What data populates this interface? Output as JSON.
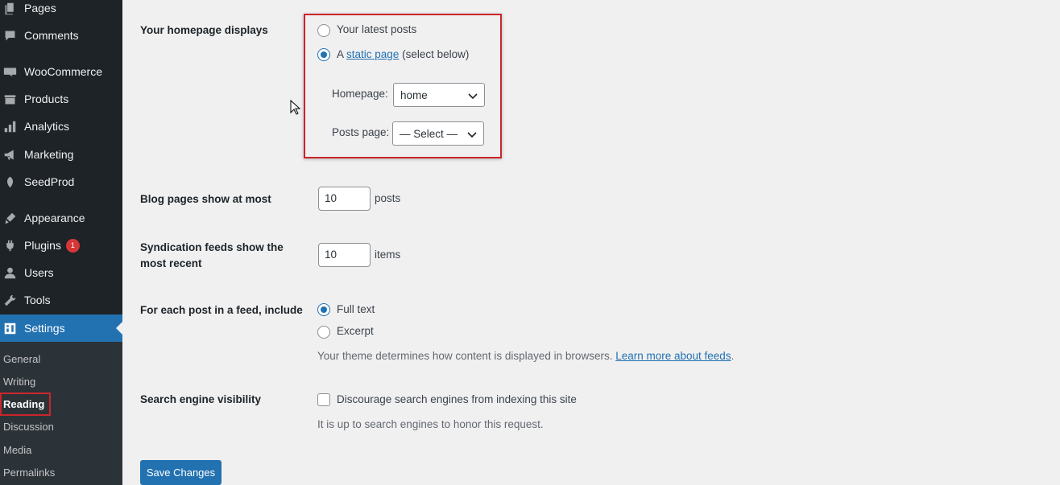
{
  "sidebar": {
    "items": [
      {
        "label": "Pages",
        "icon": "pages-icon"
      },
      {
        "label": "Comments",
        "icon": "comments-icon"
      },
      {
        "label": "WooCommerce",
        "icon": "woocommerce-icon"
      },
      {
        "label": "Products",
        "icon": "products-icon"
      },
      {
        "label": "Analytics",
        "icon": "analytics-icon"
      },
      {
        "label": "Marketing",
        "icon": "marketing-icon"
      },
      {
        "label": "SeedProd",
        "icon": "seedprod-icon"
      },
      {
        "label": "Appearance",
        "icon": "appearance-icon"
      },
      {
        "label": "Plugins",
        "icon": "plugins-icon",
        "badge": "1"
      },
      {
        "label": "Users",
        "icon": "users-icon"
      },
      {
        "label": "Tools",
        "icon": "tools-icon"
      },
      {
        "label": "Settings",
        "icon": "settings-icon"
      }
    ],
    "submenu": [
      "General",
      "Writing",
      "Reading",
      "Discussion",
      "Media",
      "Permalinks"
    ]
  },
  "homepage": {
    "label": "Your homepage displays",
    "option_latest": "Your latest posts",
    "option_static_prefix": "A",
    "option_static_link": "static page",
    "option_static_suffix": "(select below)",
    "homepage_label": "Homepage:",
    "homepage_value": "home",
    "posts_page_label": "Posts page:",
    "posts_page_value": "— Select —"
  },
  "blog_pages": {
    "label": "Blog pages show at most",
    "value": "10",
    "unit": "posts"
  },
  "syndication": {
    "label_line1": "Syndication feeds show the",
    "label_line2": "most recent",
    "value": "10",
    "unit": "items"
  },
  "feed": {
    "label": "For each post in a feed, include",
    "option_full": "Full text",
    "option_excerpt": "Excerpt",
    "description": "Your theme determines how content is displayed in browsers.",
    "link": "Learn more about feeds",
    "period": "."
  },
  "search": {
    "label": "Search engine visibility",
    "checkbox_label": "Discourage search engines from indexing this site",
    "description": "It is up to search engines to honor this request."
  },
  "save_label": "Save Changes",
  "colors": {
    "accent": "#2271b1",
    "sidebar": "#1d2327",
    "highlight": "#c9252b",
    "badge": "#d63638"
  }
}
